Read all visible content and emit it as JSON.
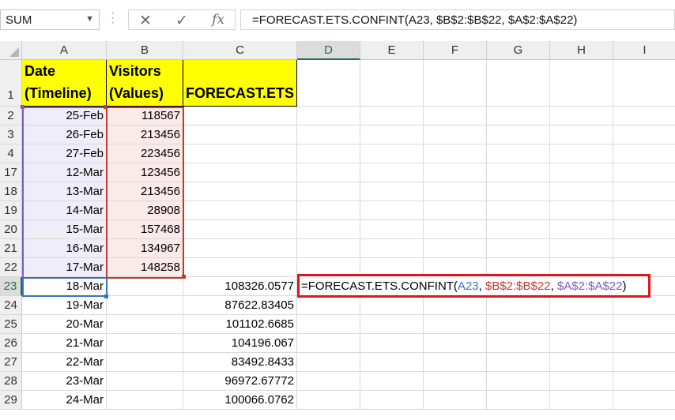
{
  "name_box": {
    "value": "SUM"
  },
  "toolbar": {
    "cancel": "✕",
    "enter": "✓",
    "fx": "fx"
  },
  "formula_bar": {
    "value": "=FORECAST.ETS.CONFINT(A23, $B$2:$B$22, $A$2:$A$22)"
  },
  "columns": [
    "A",
    "B",
    "C",
    "D",
    "E",
    "F",
    "G",
    "H",
    "I"
  ],
  "header_row": {
    "row_num": "1",
    "A1_line1": "Date",
    "A1_line2": "(Timeline)",
    "B1_line1": "Visitors",
    "B1_line2": "(Values)",
    "C1": "FORECAST.ETS"
  },
  "rows": [
    {
      "num": "2",
      "A": "25-Feb",
      "B": "118567",
      "C": ""
    },
    {
      "num": "3",
      "A": "26-Feb",
      "B": "213456",
      "C": ""
    },
    {
      "num": "4",
      "A": "27-Feb",
      "B": "223456",
      "C": ""
    },
    {
      "num": "17",
      "A": "12-Mar",
      "B": "123456",
      "C": ""
    },
    {
      "num": "18",
      "A": "13-Mar",
      "B": "213456",
      "C": ""
    },
    {
      "num": "19",
      "A": "14-Mar",
      "B": "28908",
      "C": ""
    },
    {
      "num": "20",
      "A": "15-Mar",
      "B": "157468",
      "C": ""
    },
    {
      "num": "21",
      "A": "16-Mar",
      "B": "134967",
      "C": ""
    },
    {
      "num": "22",
      "A": "17-Mar",
      "B": "148258",
      "C": ""
    },
    {
      "num": "23",
      "A": "18-Mar",
      "B": "",
      "C": "108326.0577"
    },
    {
      "num": "24",
      "A": "19-Mar",
      "B": "",
      "C": "87622.83405"
    },
    {
      "num": "25",
      "A": "20-Mar",
      "B": "",
      "C": "101102.6685"
    },
    {
      "num": "26",
      "A": "21-Mar",
      "B": "",
      "C": "104196.067"
    },
    {
      "num": "27",
      "A": "22-Mar",
      "B": "",
      "C": "83492.8433"
    },
    {
      "num": "28",
      "A": "23-Mar",
      "B": "",
      "C": "96972.67772"
    },
    {
      "num": "29",
      "A": "24-Mar",
      "B": "",
      "C": "100066.0762"
    }
  ],
  "edit_cell": {
    "prefix": "=FORECAST.ETS.CONFINT(",
    "ref1": "A23",
    "sep1": ", ",
    "ref2": "$B$2:$B$22",
    "sep2": ", ",
    "ref3": "$A$2:$A$22",
    "suffix": ")"
  },
  "colors": {
    "highlight_border": "#e0141b",
    "header_fill": "#ffff00",
    "ref_blue": "#3a6fc6",
    "ref_red": "#c0392b",
    "ref_purple": "#7e57c2"
  }
}
